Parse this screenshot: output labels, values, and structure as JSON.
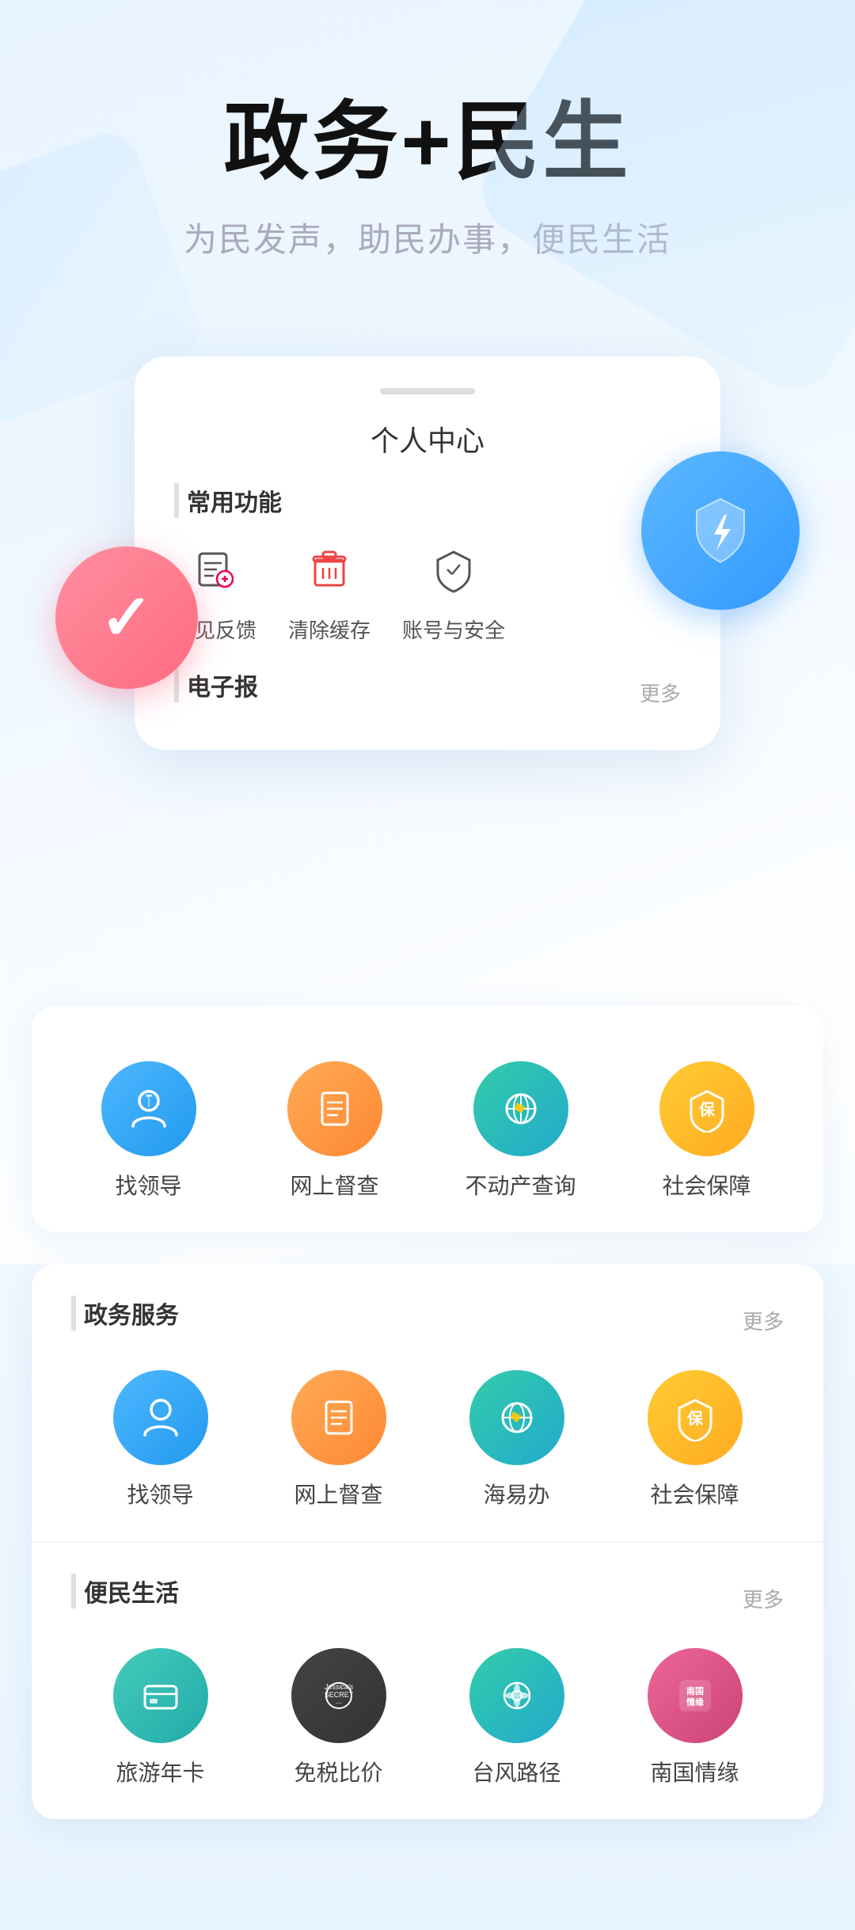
{
  "header": {
    "main_title": "政务+民生",
    "sub_title": "为民发声，助民办事，便民生活"
  },
  "phone_card": {
    "status_bar": "indicator",
    "title": "个人中心",
    "common_functions_label": "常用功能",
    "common_functions": [
      {
        "id": "feedback",
        "icon": "edit-icon",
        "label": "意见反馈"
      },
      {
        "id": "cache",
        "icon": "trash-icon",
        "label": "清除缓存"
      },
      {
        "id": "security",
        "icon": "shield-icon",
        "label": "账号与安全"
      }
    ],
    "ebook_label": "电子报",
    "more_label": "更多"
  },
  "featured_services": {
    "items": [
      {
        "id": "find-leader",
        "icon": "person-icon",
        "label": "找领导",
        "color": "blue"
      },
      {
        "id": "supervision",
        "icon": "doc-icon",
        "label": "网上督查",
        "color": "orange"
      },
      {
        "id": "property",
        "icon": "globe-icon",
        "label": "不动产查询",
        "color": "teal"
      },
      {
        "id": "social-security",
        "icon": "shield-prot-icon",
        "label": "社会保障",
        "color": "gold"
      }
    ]
  },
  "gov_services": {
    "label": "政务服务",
    "more_label": "更多",
    "items": [
      {
        "id": "find-leader",
        "label": "找领导",
        "color": "blue"
      },
      {
        "id": "supervision",
        "label": "网上督查",
        "color": "orange"
      },
      {
        "id": "haiyiban",
        "label": "海易办",
        "color": "teal"
      },
      {
        "id": "social-security",
        "label": "社会保障",
        "color": "gold"
      }
    ]
  },
  "life_services": {
    "label": "便民生活",
    "more_label": "更多",
    "items": [
      {
        "id": "tour-card",
        "label": "旅游年卡",
        "color": "green-teal"
      },
      {
        "id": "tax-free",
        "label": "免税比价",
        "color": "dark"
      },
      {
        "id": "typhoon",
        "label": "台风路径",
        "color": "teal"
      },
      {
        "id": "nanquo",
        "label": "南国情缘",
        "color": "pink"
      }
    ]
  }
}
